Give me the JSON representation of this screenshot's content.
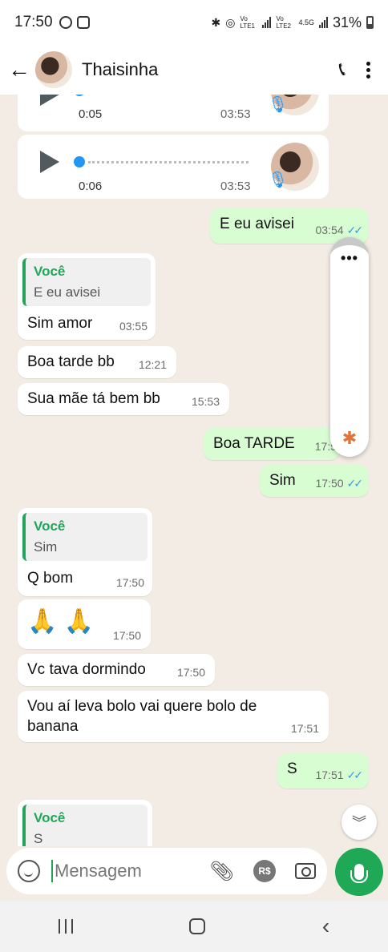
{
  "status": {
    "time": "17:50",
    "net1": "Vo LTE1",
    "net2": "Vo LTE2",
    "net_type": "4.5G",
    "battery": "31%"
  },
  "header": {
    "contact_name": "Thaisinha"
  },
  "voice_notes": [
    {
      "duration": "0:05",
      "time": "03:53"
    },
    {
      "duration": "0:06",
      "time": "03:53"
    }
  ],
  "messages": [
    {
      "id": "m1",
      "text": "E eu avisei",
      "time": "03:54",
      "ticks": "✓✓"
    },
    {
      "id": "m2",
      "quote_name": "Você",
      "quote_text": "E eu avisei",
      "text": "Sim amor",
      "time": "03:55"
    },
    {
      "id": "m3",
      "text": "Boa tarde bb",
      "time": "12:21"
    },
    {
      "id": "m4",
      "text": "Sua mãe tá bem bb",
      "time": "15:53"
    },
    {
      "id": "m5",
      "text": "Boa TARDE",
      "time": "17:5"
    },
    {
      "id": "m6",
      "text": "Sim",
      "time": "17:50",
      "ticks": "✓✓"
    },
    {
      "id": "m7",
      "quote_name": "Você",
      "quote_text": "Sim",
      "text": "Q bom",
      "time": "17:50"
    },
    {
      "id": "m8",
      "text": "🙏 🙏",
      "time": "17:50"
    },
    {
      "id": "m9",
      "text": "Vc tava dormindo",
      "time": "17:50"
    },
    {
      "id": "m10",
      "text": "Vou aí leva bolo vai quere bolo de banana",
      "time": "17:51"
    },
    {
      "id": "m11",
      "text": "S",
      "time": "17:51",
      "ticks": "✓✓"
    },
    {
      "id": "m12",
      "quote_name": "Você",
      "quote_text": "S"
    }
  ],
  "overlay": {
    "menu_glyph": "•••",
    "bluetooth_glyph": "✱"
  },
  "composer": {
    "placeholder": "Mensagem",
    "rs_label": "R$"
  },
  "colors": {
    "accent": "#1fa855",
    "outgoing_bubble": "#d9fdd3",
    "incoming_bubble": "#ffffff",
    "read_ticks": "#34a0e8"
  }
}
